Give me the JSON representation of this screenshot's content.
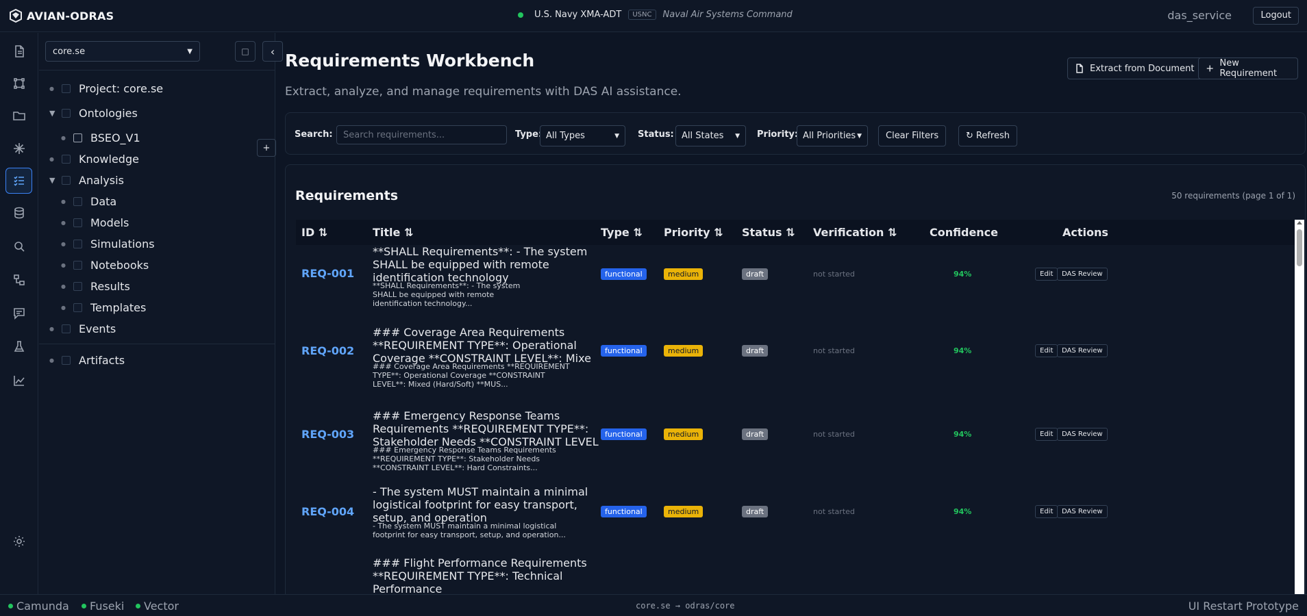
{
  "app": {
    "name": "AVIAN-ODRAS",
    "org_name": "U.S. Navy XMA-ADT",
    "org_badge": "USNC",
    "org_command": "Naval Air Systems Command",
    "username": "das_service",
    "logout_label": "Logout"
  },
  "rail": {
    "icons": [
      "document-icon",
      "bezier-icon",
      "folder-icon",
      "sparkle-icon",
      "checklist-icon",
      "database-icon",
      "search-icon",
      "workflow-icon",
      "chat-icon",
      "flask-icon",
      "chart-icon",
      "settings-icon"
    ],
    "active": "checklist-icon"
  },
  "explorer": {
    "project_select": "core.se",
    "add_label": "+",
    "tree": [
      {
        "label": "Project: core.se",
        "level": 0,
        "expandable": false
      },
      {
        "label": "Ontologies",
        "level": 0,
        "expandable": true,
        "expanded": true
      },
      {
        "label": "BSEO_V1",
        "level": 1,
        "expandable": false
      },
      {
        "label": "Knowledge",
        "level": 0,
        "expandable": false
      },
      {
        "label": "Analysis",
        "level": 0,
        "expandable": true,
        "expanded": true
      },
      {
        "label": "Data",
        "level": 1,
        "expandable": false
      },
      {
        "label": "Models",
        "level": 1,
        "expandable": false
      },
      {
        "label": "Simulations",
        "level": 1,
        "expandable": false
      },
      {
        "label": "Notebooks",
        "level": 1,
        "expandable": false
      },
      {
        "label": "Results",
        "level": 1,
        "expandable": false
      },
      {
        "label": "Templates",
        "level": 1,
        "expandable": false
      },
      {
        "label": "Events",
        "level": 0,
        "expandable": false
      },
      {
        "label": "Artifacts",
        "level": 0,
        "expandable": false
      }
    ]
  },
  "page": {
    "title": "Requirements Workbench",
    "subtitle": "Extract, analyze, and manage requirements with DAS AI assistance.",
    "extract_label": "Extract from Document",
    "new_label": "New Requirement"
  },
  "filters": {
    "search_label": "Search:",
    "search_placeholder": "Search requirements...",
    "type_label": "Type:",
    "type_value": "All Types",
    "status_label": "Status:",
    "status_value": "All States",
    "priority_label": "Priority:",
    "priority_value": "All Priorities",
    "clear_label": "Clear Filters",
    "refresh_label": "Refresh"
  },
  "requirements": {
    "heading": "Requirements",
    "count_text": "50 requirements (page 1 of 1)",
    "columns": [
      "ID ⇅",
      "Title ⇅",
      "Type ⇅",
      "Priority ⇅",
      "Status ⇅",
      "Verification ⇅",
      "Confidence",
      "Actions"
    ],
    "edit_label": "Edit",
    "review_label": "DAS Review",
    "rows": [
      {
        "id": "REQ-001",
        "title": "**SHALL Requirements**: - The system SHALL be equipped with remote identification technology",
        "desc": "**SHALL Requirements**: - The system SHALL be equipped with remote identification technology...",
        "type": "functional",
        "priority": "medium",
        "status": "draft",
        "verification": "not started",
        "confidence": "94%"
      },
      {
        "id": "REQ-002",
        "title": "### Coverage Area Requirements **REQUIREMENT TYPE**: Operational Coverage **CONSTRAINT LEVEL**: Mixe",
        "desc": "### Coverage Area Requirements **REQUIREMENT TYPE**: Operational Coverage **CONSTRAINT LEVEL**: Mixed (Hard/Soft) **MUS...",
        "type": "functional",
        "priority": "medium",
        "status": "draft",
        "verification": "not started",
        "confidence": "94%"
      },
      {
        "id": "REQ-003",
        "title": "### Emergency Response Teams Requirements **REQUIREMENT TYPE**: Stakeholder Needs **CONSTRAINT LEVEL",
        "desc": "### Emergency Response Teams Requirements **REQUIREMENT TYPE**: Stakeholder Needs **CONSTRAINT LEVEL**: Hard Constraints...",
        "type": "functional",
        "priority": "medium",
        "status": "draft",
        "verification": "not started",
        "confidence": "94%"
      },
      {
        "id": "REQ-004",
        "title": "- The system MUST maintain a minimal logistical footprint for easy transport, setup, and operation",
        "desc": "- The system MUST maintain a minimal logistical footprint for easy transport, setup, and operation...",
        "type": "functional",
        "priority": "medium",
        "status": "draft",
        "verification": "not started",
        "confidence": "94%"
      },
      {
        "id": "",
        "title": "### Flight Performance Requirements **REQUIREMENT TYPE**: Technical Performance",
        "desc": "",
        "type": "",
        "priority": "",
        "status": "",
        "verification": "",
        "confidence": ""
      }
    ]
  },
  "statusbar": {
    "services": [
      "Camunda",
      "Fuseki",
      "Vector"
    ],
    "path": "core.se → odras/core",
    "label": "UI Restart Prototype"
  }
}
